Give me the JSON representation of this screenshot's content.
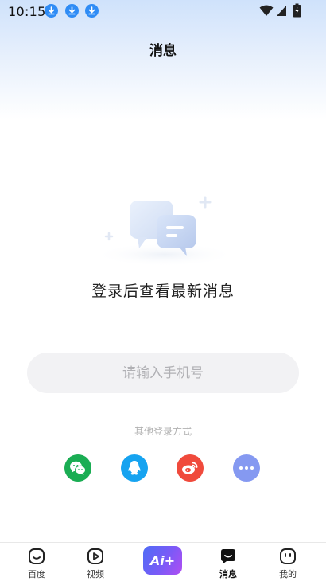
{
  "status_bar": {
    "time": "10:15",
    "notification_icons": [
      "download-icon",
      "download-icon",
      "download-icon"
    ],
    "right_icons": [
      "wifi-icon",
      "signal-icon",
      "battery-charging-icon"
    ]
  },
  "header": {
    "title": "消息"
  },
  "empty_state": {
    "illustration": "chat-bubbles-icon",
    "message": "登录后查看最新消息"
  },
  "login": {
    "phone_placeholder": "请输入手机号",
    "phone_value": "",
    "other_methods_label": "其他登录方式",
    "methods": [
      {
        "name": "wechat",
        "icon": "wechat-icon",
        "color": "#1aad53"
      },
      {
        "name": "qq",
        "icon": "qq-icon",
        "color": "#16a3f0"
      },
      {
        "name": "weibo",
        "icon": "weibo-icon",
        "color": "#f04a3c"
      },
      {
        "name": "more",
        "icon": "more-icon",
        "color": "#8599f1"
      }
    ]
  },
  "bottom_nav": {
    "items": [
      {
        "label": "百度",
        "icon": "baidu-home-icon",
        "active": false
      },
      {
        "label": "视频",
        "icon": "video-play-icon",
        "active": false
      },
      {
        "label": "Ai+",
        "icon": "ai-plus-icon",
        "active": false
      },
      {
        "label": "消息",
        "icon": "message-icon",
        "active": true
      },
      {
        "label": "我的",
        "icon": "profile-icon",
        "active": false
      }
    ]
  },
  "colors": {
    "accent_blue": "#2f8cf5",
    "ai_gradient_start": "#4f6df5",
    "ai_gradient_end": "#b04ef2"
  }
}
